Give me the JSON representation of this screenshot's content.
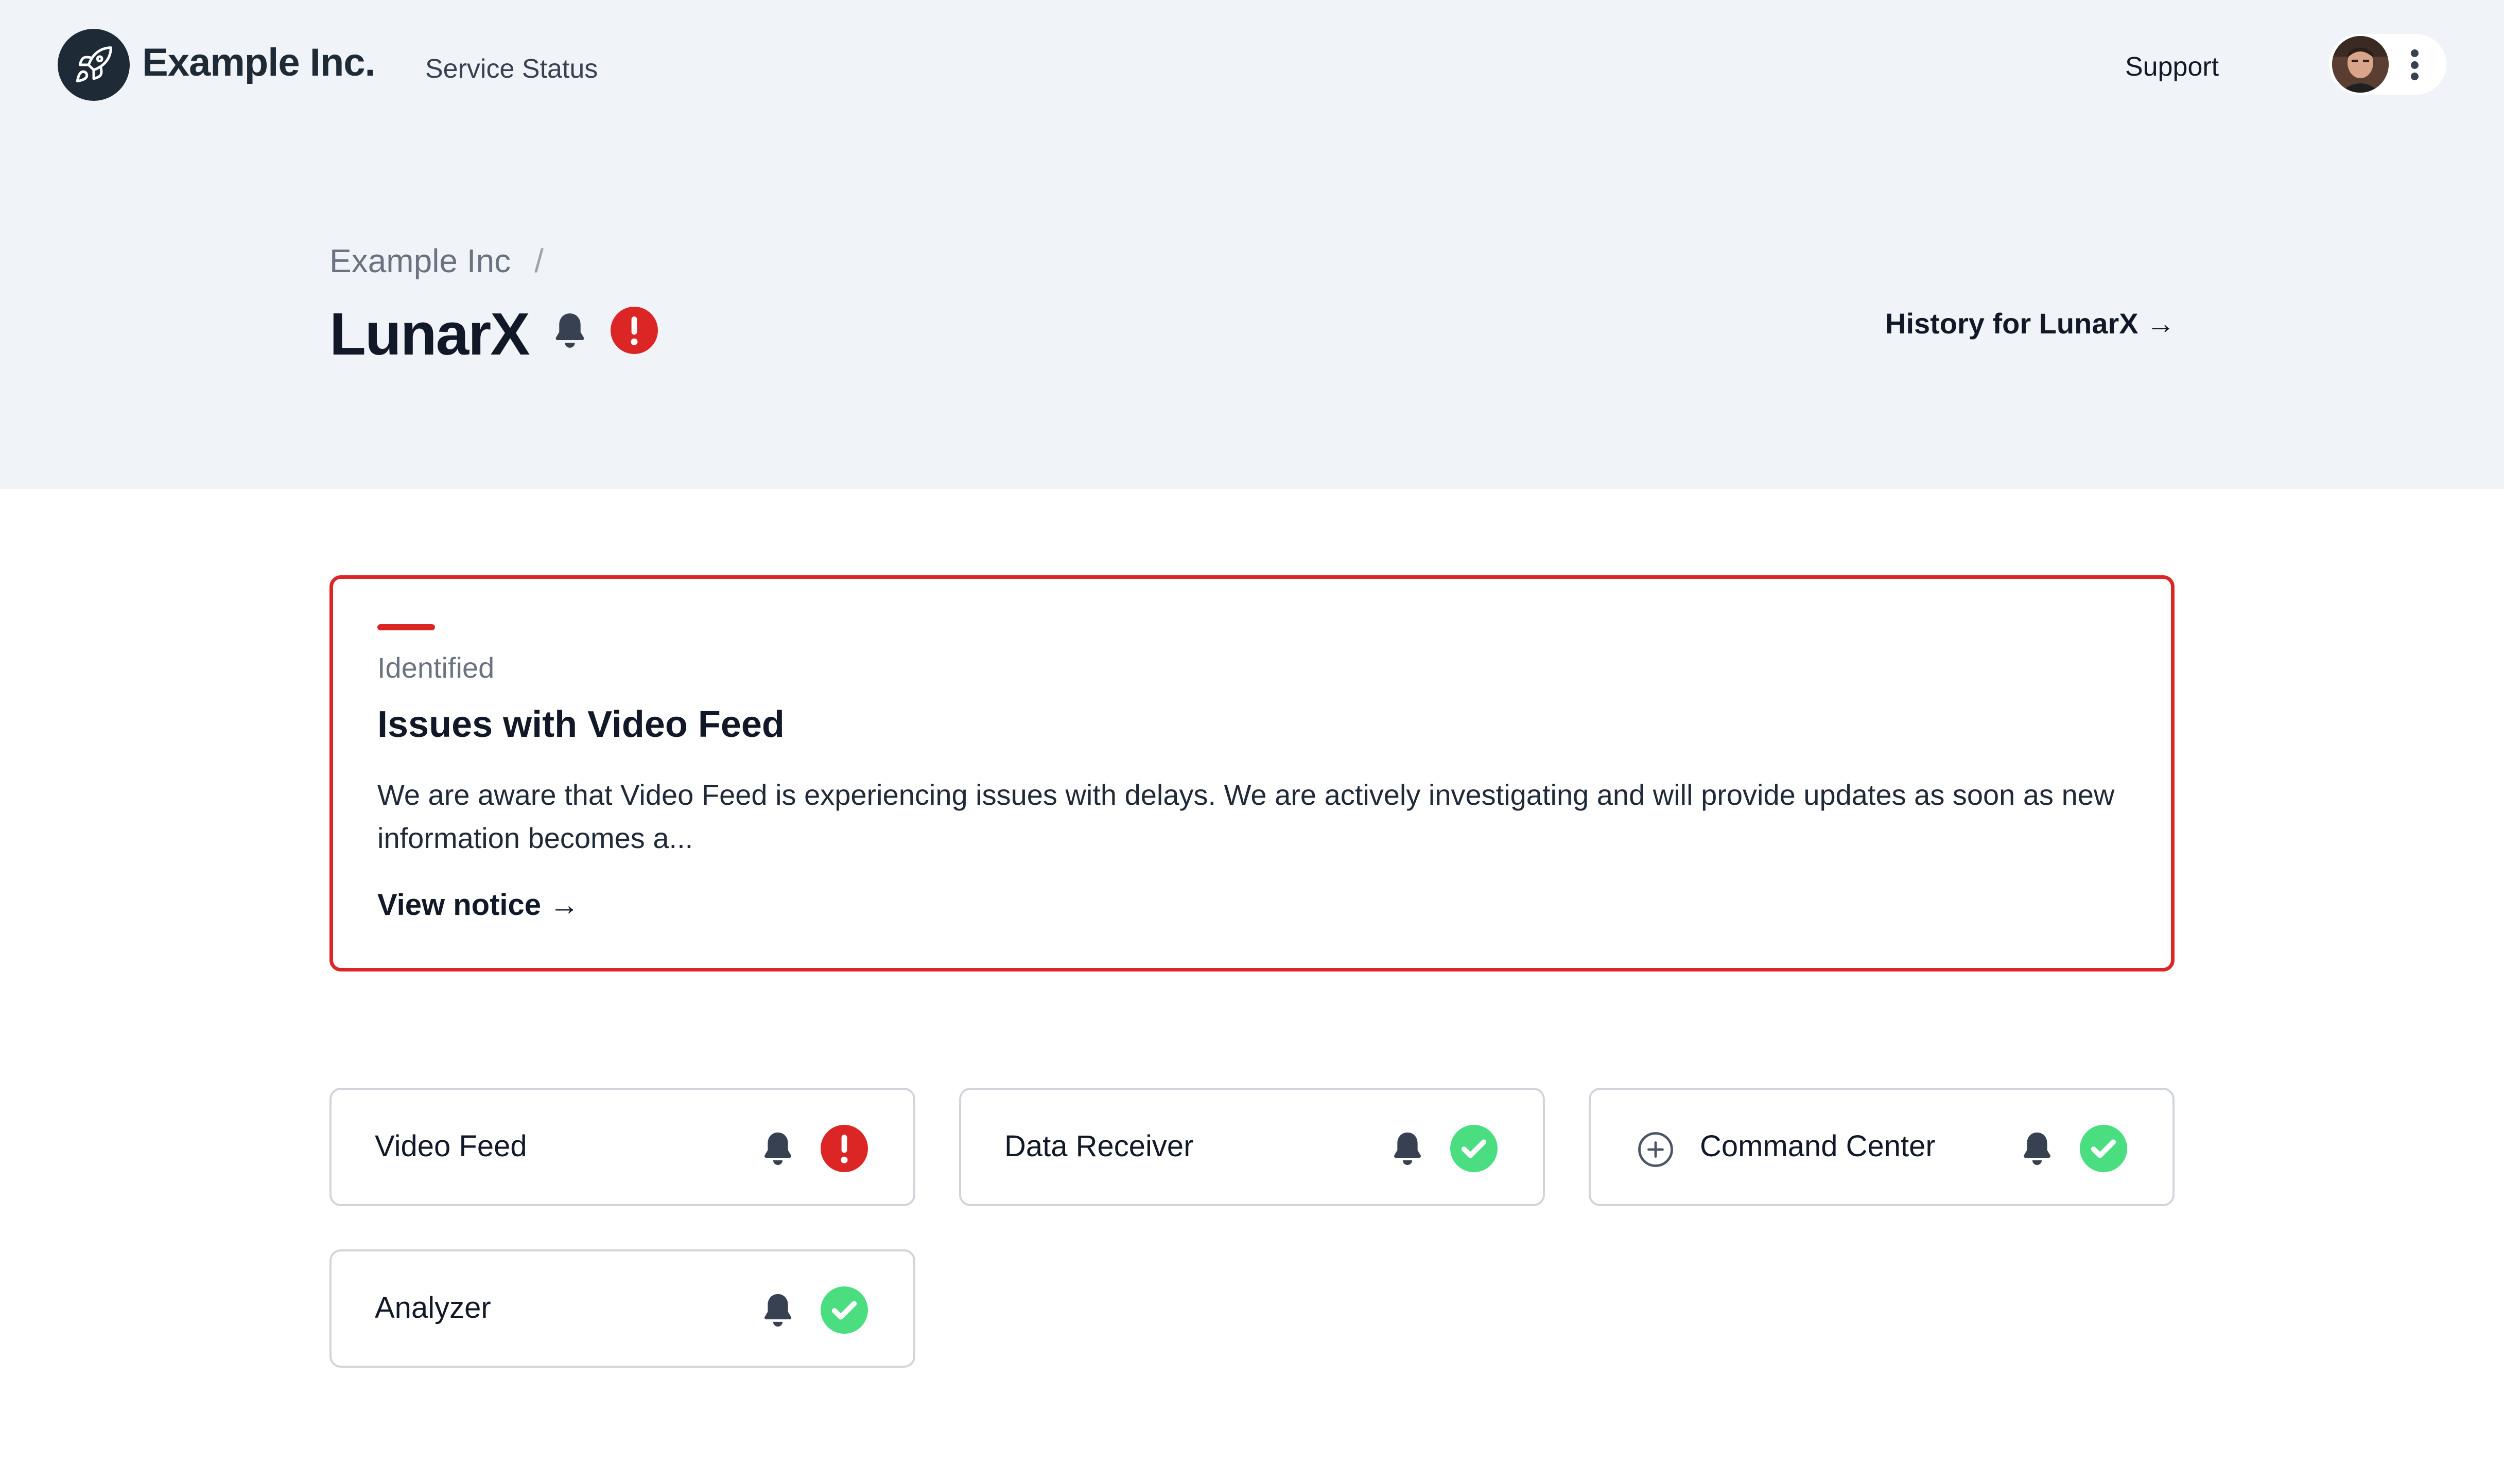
{
  "header": {
    "brand_name": "Example Inc.",
    "nav_service_status": "Service Status",
    "nav_support": "Support",
    "logo_icon": "rocket-icon",
    "user_menu_icon": "kebab-menu-icon"
  },
  "page": {
    "breadcrumb_parent": "Example Inc",
    "breadcrumb_separator": "/",
    "title": "LunarX",
    "title_status": "major-outage",
    "history_link": "History for LunarX →"
  },
  "notice": {
    "status": "Identified",
    "title": "Issues with Video Feed",
    "body": "We are aware that Video Feed is experiencing issues with delays. We are actively investigating and will provide updates as soon as new information becomes a...",
    "link": "View notice →"
  },
  "components": [
    {
      "name": "Video Feed",
      "status": "outage",
      "expandable": false
    },
    {
      "name": "Data Receiver",
      "status": "operational",
      "expandable": false
    },
    {
      "name": "Command Center",
      "status": "operational",
      "expandable": true
    },
    {
      "name": "Analyzer",
      "status": "operational",
      "expandable": false
    }
  ],
  "colors": {
    "hero_background": "#f0f4f9",
    "outage_red": "#dc2626",
    "operational_green": "#4ade80",
    "ink": "#111827",
    "muted": "#6b7280",
    "card_border": "#d1d5db"
  }
}
